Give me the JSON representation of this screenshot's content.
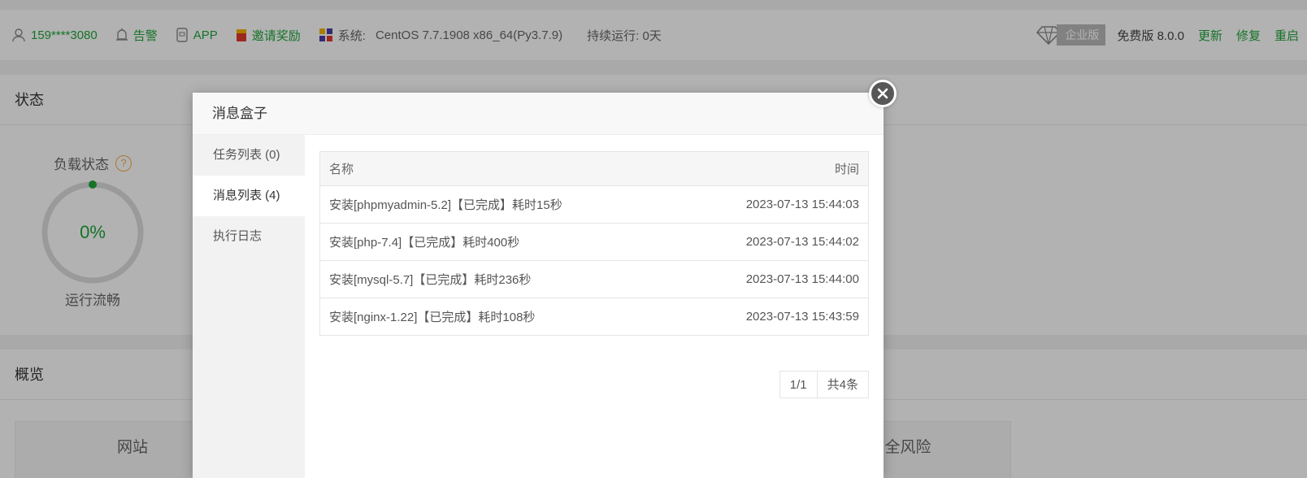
{
  "header": {
    "user": "159****3080",
    "alarm": "告警",
    "app": "APP",
    "invite": "邀请奖励",
    "system_label": "系统:",
    "system_value": "CentOS 7.7.1908 x86_64(Py3.7.9)",
    "uptime": "持续运行: 0天",
    "enterprise": "企业版",
    "edition": "免费版 8.0.0",
    "update": "更新",
    "repair": "修复",
    "restart": "重启"
  },
  "status_card": {
    "title": "状态",
    "load_label": "负载状态",
    "help": "?",
    "load_value": "0%",
    "load_status": "运行流畅"
  },
  "overview_card": {
    "title": "概览",
    "box_site": "网站",
    "box_risk": "全风险"
  },
  "modal": {
    "title": "消息盒子",
    "tabs": [
      {
        "label": "任务列表 (0)",
        "active": false
      },
      {
        "label": "消息列表 (4)",
        "active": true
      },
      {
        "label": "执行日志",
        "active": false
      }
    ],
    "table": {
      "col_name": "名称",
      "col_time": "时间",
      "rows": [
        {
          "name": "安装[phpmyadmin-5.2]【已完成】耗时15秒",
          "time": "2023-07-13 15:44:03"
        },
        {
          "name": "安装[php-7.4]【已完成】耗时400秒",
          "time": "2023-07-13 15:44:02"
        },
        {
          "name": "安装[mysql-5.7]【已完成】耗时236秒",
          "time": "2023-07-13 15:44:00"
        },
        {
          "name": "安装[nginx-1.22]【已完成】耗时108秒",
          "time": "2023-07-13 15:43:59"
        }
      ]
    },
    "pager": {
      "page": "1/1",
      "total": "共4条"
    }
  },
  "colors": {
    "accent": "#20a53a",
    "warning": "#f0ad4e"
  }
}
